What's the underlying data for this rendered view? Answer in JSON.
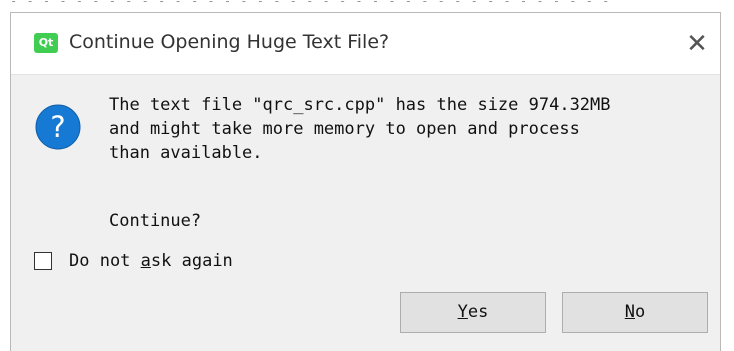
{
  "dialog": {
    "title": "Continue Opening Huge Text File?",
    "close_glyph": "✕",
    "app_icon": "qt-icon",
    "app_icon_text": "Qt",
    "message_icon": "question-icon",
    "message_icon_glyph": "?",
    "message_lines": [
      "The text file \"qrc_src.cpp\" has the size 974.32MB",
      "and might take more memory to open and process",
      "than available."
    ],
    "question": "Continue?",
    "checkbox": {
      "label": "Do not ask again",
      "label_before_mnemonic": "Do not ",
      "label_mnemonic": "a",
      "label_after_mnemonic": "sk again",
      "checked": false
    },
    "buttons": {
      "yes": {
        "label": "Yes",
        "mnemonic": "Y",
        "rest": "es"
      },
      "no": {
        "label": "No",
        "mnemonic": "N",
        "rest": "o"
      }
    }
  },
  "colors": {
    "accent_blue": "#1679d4",
    "qt_green": "#41cd52",
    "dialog_bg": "#f0f0f0",
    "button_bg": "#e1e1e1"
  }
}
